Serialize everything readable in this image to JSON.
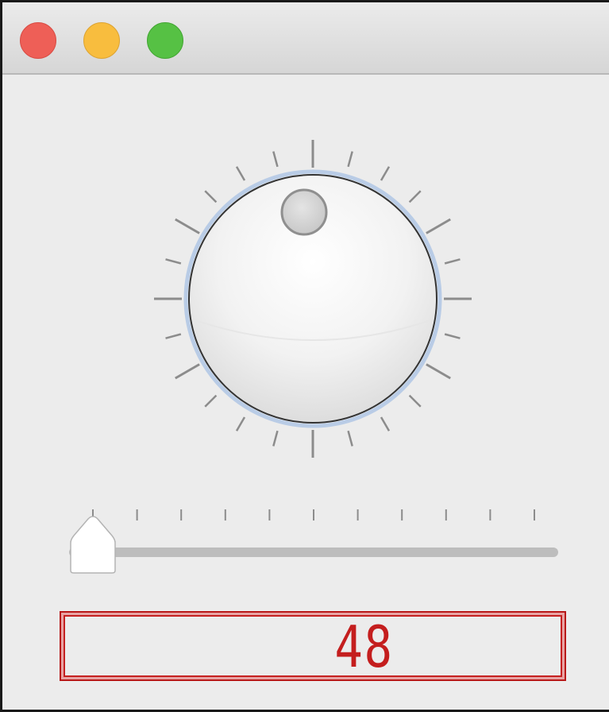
{
  "window": {
    "controls": [
      "close",
      "minimize",
      "zoom"
    ]
  },
  "knob": {
    "indicator": "dot",
    "tick_count": 24
  },
  "slider": {
    "tick_count": 11,
    "value_fraction": 0.0
  },
  "display": {
    "value": "48",
    "color": "#c41e1e"
  }
}
